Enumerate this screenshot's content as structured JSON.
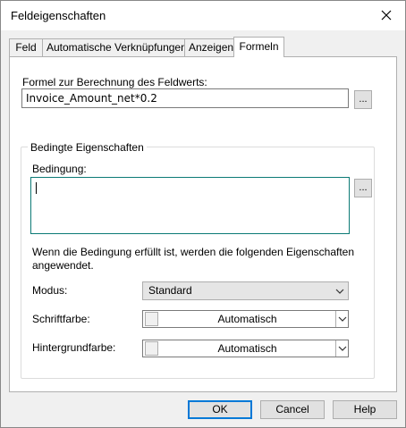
{
  "window": {
    "title": "Feldeigenschaften"
  },
  "tabs": [
    {
      "label": "Feld"
    },
    {
      "label": "Automatische Verknüpfungen"
    },
    {
      "label": "Anzeigen"
    },
    {
      "label": "Formeln"
    }
  ],
  "active_tab": "Formeln",
  "formula": {
    "label": "Formel zur Berechnung des Feldwerts:",
    "value": "Invoice_Amount_net*0.2",
    "browse_label": "..."
  },
  "conditional": {
    "group_title": "Bedingte Eigenschaften",
    "condition_label": "Bedingung:",
    "condition_value": "",
    "browse_label": "...",
    "info_text_line1": "Wenn die Bedingung erfüllt ist, werden die folgenden Eigenschaften",
    "info_text_line2": "angewendet.",
    "mode_label": "Modus:",
    "mode_value": "Standard",
    "font_color_label": "Schriftfarbe:",
    "font_color_value": "Automatisch",
    "bg_color_label": "Hintergrundfarbe:",
    "bg_color_value": "Automatisch"
  },
  "buttons": {
    "ok": "OK",
    "cancel": "Cancel",
    "help": "Help"
  },
  "colors": {
    "accent": "#0078d7",
    "focus_border": "#0b7a75"
  }
}
